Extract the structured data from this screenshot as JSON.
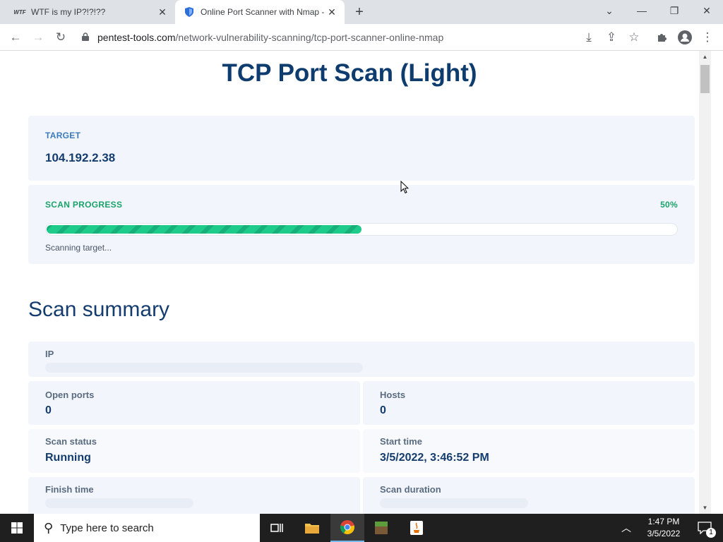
{
  "browser": {
    "tabs": [
      {
        "title": "WTF is my IP?!?!??",
        "favicon": "WTF"
      },
      {
        "title": "Online Port Scanner with Nmap -",
        "favicon": "shield-icon"
      }
    ],
    "url_host": "pentest-tools.com",
    "url_path": "/network-vulnerability-scanning/tcp-port-scanner-online-nmap"
  },
  "page": {
    "title": "TCP Port Scan (Light)",
    "target": {
      "label": "TARGET",
      "value": "104.192.2.38"
    },
    "progress": {
      "label": "SCAN PROGRESS",
      "percent_text": "50%",
      "value": 0.5,
      "note": "Scanning target..."
    },
    "summary": {
      "title": "Scan summary",
      "ip_label": "IP",
      "open_ports_label": "Open ports",
      "open_ports_value": "0",
      "hosts_label": "Hosts",
      "hosts_value": "0",
      "scan_status_label": "Scan status",
      "scan_status_value": "Running",
      "start_time_label": "Start time",
      "start_time_value": "3/5/2022, 3:46:52 PM",
      "finish_time_label": "Finish time",
      "scan_duration_label": "Scan duration"
    }
  },
  "taskbar": {
    "search_placeholder": "Type here to search",
    "time": "1:47 PM",
    "date": "3/5/2022",
    "notification_count": "1"
  },
  "colors": {
    "heading": "#0f3c6e",
    "target_label": "#3a7bbd",
    "progress_label": "#1aa36a",
    "progress_fill": "#1ecb8b",
    "card_bg": "#f2f6fc"
  }
}
